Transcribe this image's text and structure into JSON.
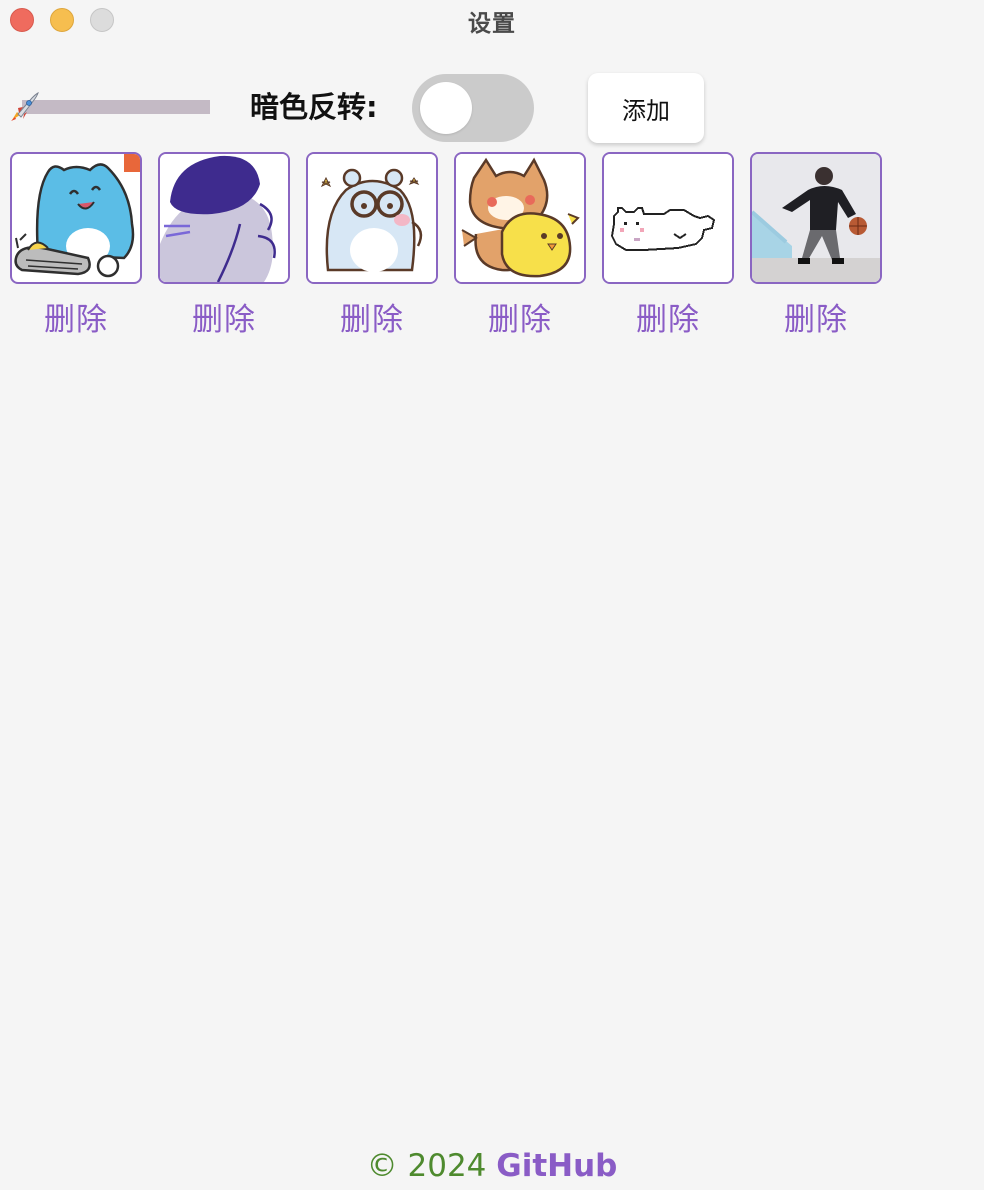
{
  "window": {
    "title": "设置"
  },
  "controls": {
    "progress_fraction": 0.0,
    "invert_label": "暗色反转:",
    "invert_enabled": false,
    "add_label": "添加"
  },
  "stickers": [
    {
      "name": "blue-cat-typing",
      "delete_label": "删除"
    },
    {
      "name": "purple-beret-character",
      "delete_label": "删除"
    },
    {
      "name": "bear-with-glasses",
      "delete_label": "删除"
    },
    {
      "name": "shiba-and-duck",
      "delete_label": "删除"
    },
    {
      "name": "pixel-white-cat",
      "delete_label": "删除"
    },
    {
      "name": "dribbling-player-photo",
      "delete_label": "删除"
    }
  ],
  "footer": {
    "copyright": "© 2024",
    "link": "GitHub"
  },
  "colors": {
    "accent": "#8a5cc6",
    "footer_green": "#4e8a2e",
    "toggle_off": "#cbcbcb"
  }
}
